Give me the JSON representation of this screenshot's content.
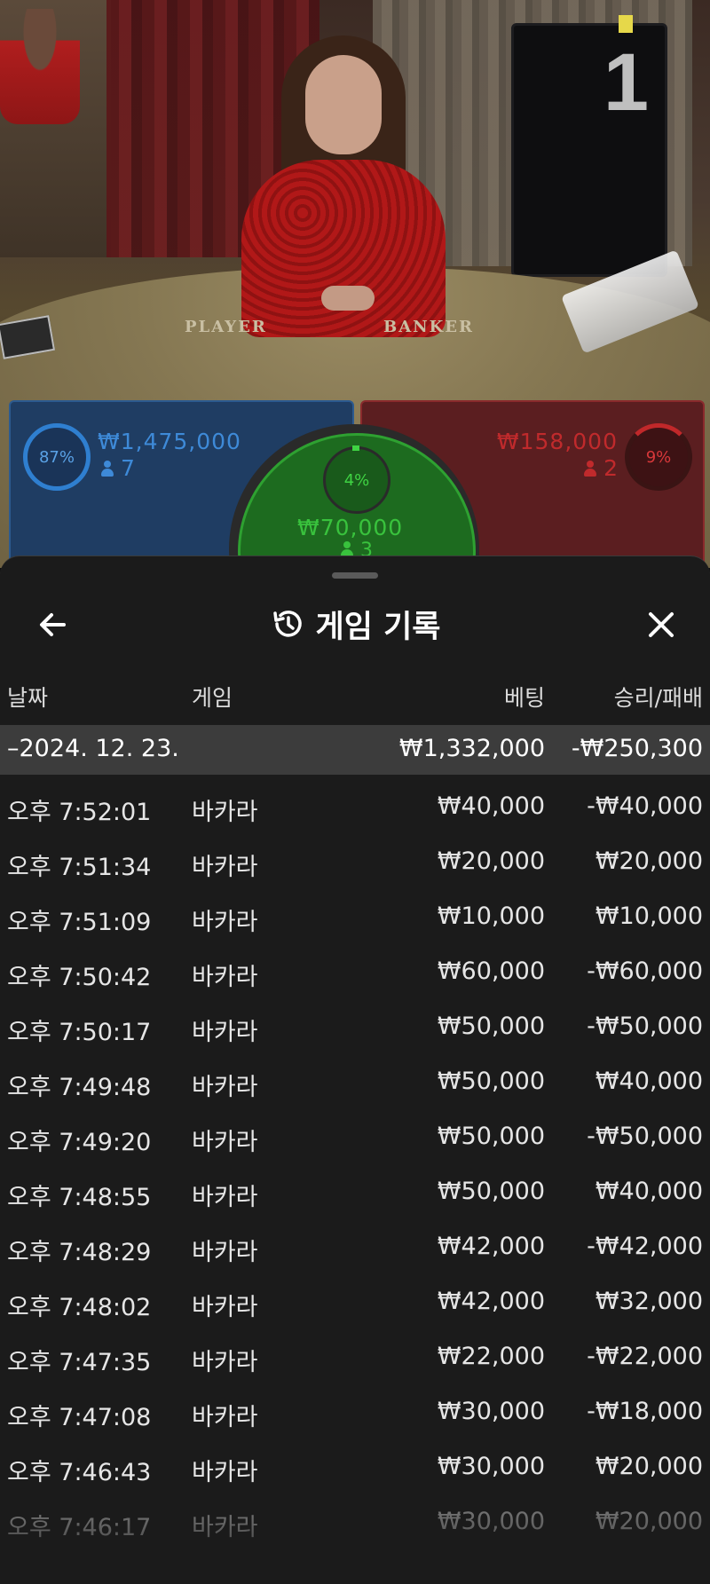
{
  "table": {
    "number": "1",
    "player_label": "PLAYER",
    "banker_label": "BANKER"
  },
  "bets": {
    "player": {
      "percent": "87%",
      "amount": "₩1,475,000",
      "players": "7",
      "color": "#2f7fd0"
    },
    "banker": {
      "percent": "9%",
      "amount": "₩158,000",
      "players": "2",
      "color": "#c0282a"
    },
    "tie": {
      "percent": "4%",
      "amount": "₩70,000",
      "players": "3",
      "color": "#39c23d"
    }
  },
  "sheet": {
    "title": "게임 기록",
    "icons": {
      "back": "arrow-left-icon",
      "close": "close-icon",
      "title": "history-icon"
    },
    "columns": {
      "date": "날짜",
      "game": "게임",
      "bet": "베팅",
      "result": "승리/패배"
    },
    "day": {
      "date": "–2024. 12. 23.",
      "bet": "₩1,332,000",
      "result": "-₩250,300"
    },
    "rows": [
      {
        "time": "오후 7:52:01",
        "game": "바카라",
        "bet": "₩40,000",
        "result": "-₩40,000"
      },
      {
        "time": "오후 7:51:34",
        "game": "바카라",
        "bet": "₩20,000",
        "result": "₩20,000"
      },
      {
        "time": "오후 7:51:09",
        "game": "바카라",
        "bet": "₩10,000",
        "result": "₩10,000"
      },
      {
        "time": "오후 7:50:42",
        "game": "바카라",
        "bet": "₩60,000",
        "result": "-₩60,000"
      },
      {
        "time": "오후 7:50:17",
        "game": "바카라",
        "bet": "₩50,000",
        "result": "-₩50,000"
      },
      {
        "time": "오후 7:49:48",
        "game": "바카라",
        "bet": "₩50,000",
        "result": "₩40,000"
      },
      {
        "time": "오후 7:49:20",
        "game": "바카라",
        "bet": "₩50,000",
        "result": "-₩50,000"
      },
      {
        "time": "오후 7:48:55",
        "game": "바카라",
        "bet": "₩50,000",
        "result": "₩40,000"
      },
      {
        "time": "오후 7:48:29",
        "game": "바카라",
        "bet": "₩42,000",
        "result": "-₩42,000"
      },
      {
        "time": "오후 7:48:02",
        "game": "바카라",
        "bet": "₩42,000",
        "result": "₩32,000"
      },
      {
        "time": "오후 7:47:35",
        "game": "바카라",
        "bet": "₩22,000",
        "result": "-₩22,000"
      },
      {
        "time": "오후 7:47:08",
        "game": "바카라",
        "bet": "₩30,000",
        "result": "-₩18,000"
      },
      {
        "time": "오후 7:46:43",
        "game": "바카라",
        "bet": "₩30,000",
        "result": "₩20,000"
      },
      {
        "time": "오후 7:46:17",
        "game": "바카라",
        "bet": "₩30,000",
        "result": "₩20,000"
      }
    ]
  }
}
